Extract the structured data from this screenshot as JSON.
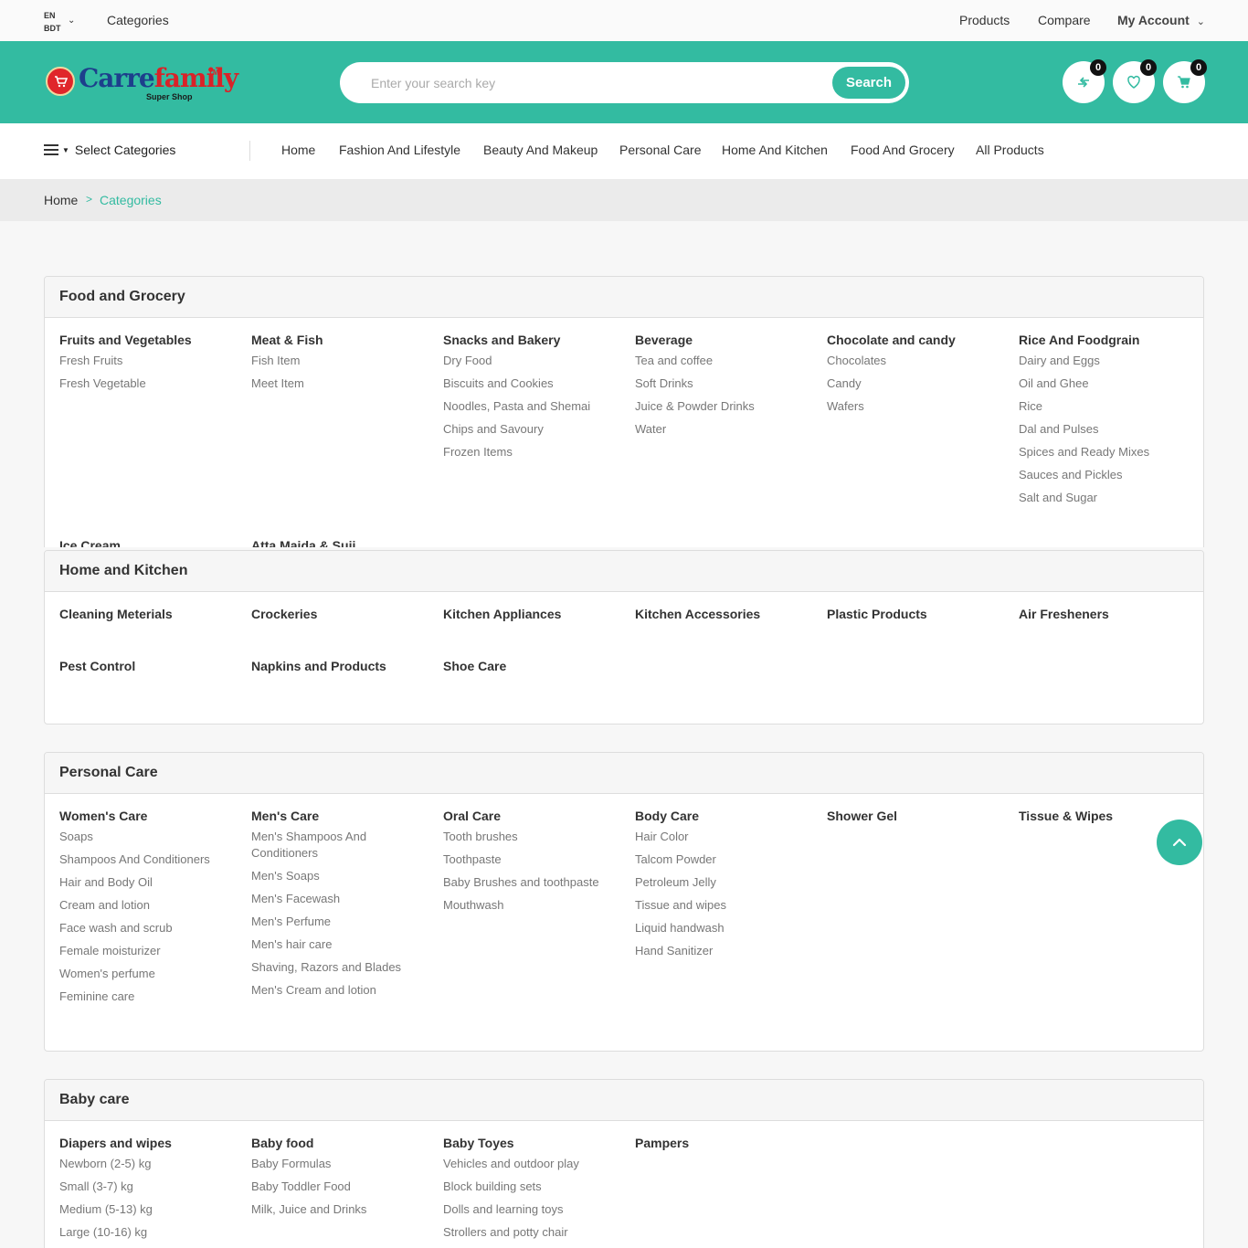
{
  "topbar": {
    "lang": "EN",
    "currency": "BDT",
    "categories_link": "Categories",
    "products": "Products",
    "compare": "Compare",
    "my_account": "My Account"
  },
  "header": {
    "logo_part1": "Carre",
    "logo_part2": "family",
    "logo_tm": "TM",
    "logo_sub": "Super Shop",
    "search_placeholder": "Enter your search key",
    "search_button": "Search",
    "compare_count": "0",
    "wishlist_count": "0",
    "cart_count": "0"
  },
  "nav": {
    "select_categories": "Select Categories",
    "items": [
      "Home",
      "Fashion And Lifestyle",
      "Beauty And Makeup",
      "Personal Care",
      "Home And Kitchen",
      "Food And Grocery",
      "All Products"
    ]
  },
  "breadcrumb": {
    "home": "Home",
    "sep": ">",
    "current": "Categories"
  },
  "sections": [
    {
      "title": "Food and Grocery",
      "columns": [
        {
          "title": "Fruits and Vegetables",
          "items": [
            "Fresh Fruits",
            "Fresh Vegetable"
          ]
        },
        {
          "title": "Meat & Fish",
          "items": [
            "Fish Item",
            "Meet Item"
          ]
        },
        {
          "title": "Snacks and Bakery",
          "items": [
            "Dry Food",
            "Biscuits and Cookies",
            "Noodles, Pasta and Shemai",
            "Chips and Savoury",
            "Frozen Items"
          ]
        },
        {
          "title": "Beverage",
          "items": [
            "Tea and coffee",
            "Soft Drinks",
            "Juice & Powder Drinks",
            "Water"
          ]
        },
        {
          "title": "Chocolate and candy",
          "items": [
            "Chocolates",
            "Candy",
            "Wafers"
          ]
        },
        {
          "title": "Rice And Foodgrain",
          "items": [
            "Dairy and Eggs",
            "Oil and Ghee",
            "Rice",
            "Dal and Pulses",
            "Spices and Ready Mixes",
            "Sauces and Pickles",
            "Salt and Sugar"
          ]
        },
        {
          "title": "Ice Cream",
          "items": []
        },
        {
          "title": "Atta Maida & Suji",
          "items": []
        }
      ]
    },
    {
      "title": "Home and Kitchen",
      "columns": [
        {
          "title": "Cleaning Meterials",
          "items": []
        },
        {
          "title": "Crockeries",
          "items": []
        },
        {
          "title": "Kitchen Appliances",
          "items": []
        },
        {
          "title": "Kitchen Accessories",
          "items": []
        },
        {
          "title": "Plastic Products",
          "items": []
        },
        {
          "title": "Air Fresheners",
          "items": []
        },
        {
          "title": "Pest Control",
          "items": []
        },
        {
          "title": "Napkins and Products",
          "items": []
        },
        {
          "title": "Shoe Care",
          "items": []
        }
      ]
    },
    {
      "title": "Personal Care",
      "columns": [
        {
          "title": "Women's Care",
          "items": [
            "Soaps",
            "Shampoos And Conditioners",
            "Hair and Body Oil",
            "Cream and lotion",
            "Face wash and scrub",
            "Female moisturizer",
            "Women's perfume",
            "Feminine care"
          ]
        },
        {
          "title": "Men's Care",
          "items": [
            "Men's Shampoos And Conditioners",
            "Men's Soaps",
            "Men's Facewash",
            "Men's Perfume",
            "Men's hair care",
            "Shaving, Razors and Blades",
            "Men's Cream and lotion"
          ]
        },
        {
          "title": "Oral Care",
          "items": [
            "Tooth brushes",
            "Toothpaste",
            "Baby Brushes and toothpaste",
            "Mouthwash"
          ]
        },
        {
          "title": "Body Care",
          "items": [
            "Hair Color",
            "Talcom Powder",
            "Petroleum Jelly",
            "Tissue and wipes",
            "Liquid handwash",
            "Hand Sanitizer"
          ]
        },
        {
          "title": "Shower Gel",
          "items": []
        },
        {
          "title": "Tissue & Wipes",
          "items": []
        }
      ]
    },
    {
      "title": "Baby care",
      "columns": [
        {
          "title": "Diapers and wipes",
          "items": [
            "Newborn (2-5) kg",
            "Small (3-7) kg",
            "Medium (5-13) kg",
            "Large (10-16) kg"
          ]
        },
        {
          "title": "Baby food",
          "items": [
            "Baby Formulas",
            "Baby Toddler Food",
            "Milk, Juice and Drinks"
          ]
        },
        {
          "title": "Baby Toyes",
          "items": [
            "Vehicles and outdoor play",
            "Block building sets",
            "Dolls and learning toys",
            "Strollers and potty chair"
          ]
        },
        {
          "title": "Pampers",
          "items": []
        }
      ]
    }
  ],
  "icons": {
    "compare": "compare-icon",
    "wishlist": "heart-icon",
    "cart": "cart-icon",
    "scroll_top": "chevron-up-icon"
  },
  "colors": {
    "brand": "#33bba1",
    "logo_blue": "#1d3f8c",
    "logo_red": "#d92228"
  }
}
